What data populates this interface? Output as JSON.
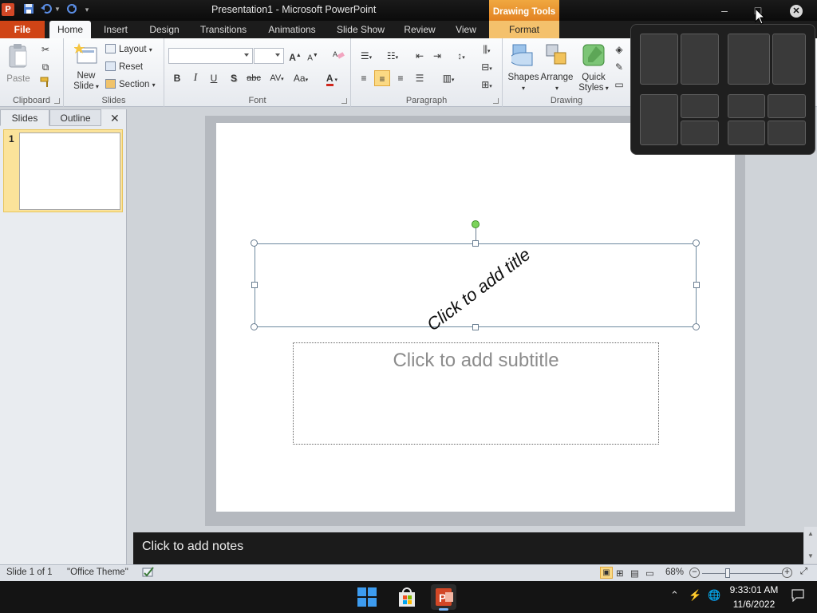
{
  "window": {
    "title": "Presentation1  -  Microsoft PowerPoint",
    "app_icon": "P",
    "contextual_tab_group": "Drawing Tools"
  },
  "tabs": [
    {
      "label": "File"
    },
    {
      "label": "Home"
    },
    {
      "label": "Insert"
    },
    {
      "label": "Design"
    },
    {
      "label": "Transitions"
    },
    {
      "label": "Animations"
    },
    {
      "label": "Slide Show"
    },
    {
      "label": "Review"
    },
    {
      "label": "View"
    },
    {
      "label": "Format"
    }
  ],
  "ribbon": {
    "clipboard": {
      "label": "Clipboard",
      "paste": "Paste"
    },
    "slides": {
      "label": "Slides",
      "new_slide_line1": "New",
      "new_slide_line2": "Slide",
      "layout": "Layout",
      "reset": "Reset",
      "section": "Section"
    },
    "font": {
      "label": "Font",
      "font_name": "",
      "font_size": "",
      "bold": "B",
      "italic": "I",
      "underline": "U",
      "shadow": "S",
      "strike": "abc",
      "spacing": "AV",
      "change_case": "Aa",
      "font_color": "A"
    },
    "paragraph": {
      "label": "Paragraph"
    },
    "drawing": {
      "label": "Drawing",
      "shapes": "Shapes",
      "arrange": "Arrange",
      "quick_styles_line1": "Quick",
      "quick_styles_line2": "Styles"
    }
  },
  "left_panel": {
    "tab_slides": "Slides",
    "tab_outline": "Outline",
    "slide_number": "1"
  },
  "slide": {
    "title_placeholder": "Click to add title",
    "subtitle_placeholder": "Click to add subtitle"
  },
  "notes_placeholder": "Click to add notes",
  "status": {
    "slide_info": "Slide 1 of 1",
    "theme": "\"Office Theme\"",
    "zoom": "68%",
    "zoom_fraction": 0.68
  },
  "taskbar": {
    "time": "9:33:01 AM",
    "date": "11/6/2022"
  },
  "colors": {
    "file_tab": "#d04416",
    "contextual_orange": "#e07c1e",
    "selection_handle": "#6b7f92",
    "rotate_handle": "#7bd35a",
    "snap_bg": "#1f1f1f"
  }
}
